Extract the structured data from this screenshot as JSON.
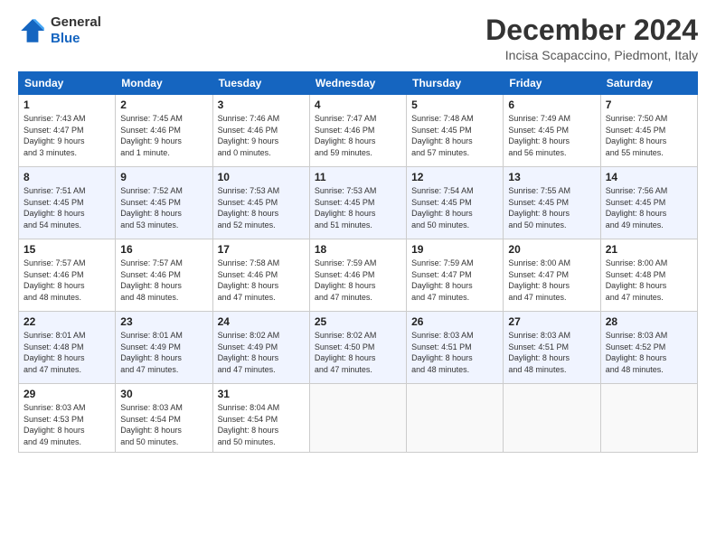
{
  "logo": {
    "line1": "General",
    "line2": "Blue"
  },
  "header": {
    "month": "December 2024",
    "location": "Incisa Scapaccino, Piedmont, Italy"
  },
  "weekdays": [
    "Sunday",
    "Monday",
    "Tuesday",
    "Wednesday",
    "Thursday",
    "Friday",
    "Saturday"
  ],
  "weeks": [
    [
      {
        "day": 1,
        "info": "Sunrise: 7:43 AM\nSunset: 4:47 PM\nDaylight: 9 hours\nand 3 minutes."
      },
      {
        "day": 2,
        "info": "Sunrise: 7:45 AM\nSunset: 4:46 PM\nDaylight: 9 hours\nand 1 minute."
      },
      {
        "day": 3,
        "info": "Sunrise: 7:46 AM\nSunset: 4:46 PM\nDaylight: 9 hours\nand 0 minutes."
      },
      {
        "day": 4,
        "info": "Sunrise: 7:47 AM\nSunset: 4:46 PM\nDaylight: 8 hours\nand 59 minutes."
      },
      {
        "day": 5,
        "info": "Sunrise: 7:48 AM\nSunset: 4:45 PM\nDaylight: 8 hours\nand 57 minutes."
      },
      {
        "day": 6,
        "info": "Sunrise: 7:49 AM\nSunset: 4:45 PM\nDaylight: 8 hours\nand 56 minutes."
      },
      {
        "day": 7,
        "info": "Sunrise: 7:50 AM\nSunset: 4:45 PM\nDaylight: 8 hours\nand 55 minutes."
      }
    ],
    [
      {
        "day": 8,
        "info": "Sunrise: 7:51 AM\nSunset: 4:45 PM\nDaylight: 8 hours\nand 54 minutes."
      },
      {
        "day": 9,
        "info": "Sunrise: 7:52 AM\nSunset: 4:45 PM\nDaylight: 8 hours\nand 53 minutes."
      },
      {
        "day": 10,
        "info": "Sunrise: 7:53 AM\nSunset: 4:45 PM\nDaylight: 8 hours\nand 52 minutes."
      },
      {
        "day": 11,
        "info": "Sunrise: 7:53 AM\nSunset: 4:45 PM\nDaylight: 8 hours\nand 51 minutes."
      },
      {
        "day": 12,
        "info": "Sunrise: 7:54 AM\nSunset: 4:45 PM\nDaylight: 8 hours\nand 50 minutes."
      },
      {
        "day": 13,
        "info": "Sunrise: 7:55 AM\nSunset: 4:45 PM\nDaylight: 8 hours\nand 50 minutes."
      },
      {
        "day": 14,
        "info": "Sunrise: 7:56 AM\nSunset: 4:45 PM\nDaylight: 8 hours\nand 49 minutes."
      }
    ],
    [
      {
        "day": 15,
        "info": "Sunrise: 7:57 AM\nSunset: 4:46 PM\nDaylight: 8 hours\nand 48 minutes."
      },
      {
        "day": 16,
        "info": "Sunrise: 7:57 AM\nSunset: 4:46 PM\nDaylight: 8 hours\nand 48 minutes."
      },
      {
        "day": 17,
        "info": "Sunrise: 7:58 AM\nSunset: 4:46 PM\nDaylight: 8 hours\nand 47 minutes."
      },
      {
        "day": 18,
        "info": "Sunrise: 7:59 AM\nSunset: 4:46 PM\nDaylight: 8 hours\nand 47 minutes."
      },
      {
        "day": 19,
        "info": "Sunrise: 7:59 AM\nSunset: 4:47 PM\nDaylight: 8 hours\nand 47 minutes."
      },
      {
        "day": 20,
        "info": "Sunrise: 8:00 AM\nSunset: 4:47 PM\nDaylight: 8 hours\nand 47 minutes."
      },
      {
        "day": 21,
        "info": "Sunrise: 8:00 AM\nSunset: 4:48 PM\nDaylight: 8 hours\nand 47 minutes."
      }
    ],
    [
      {
        "day": 22,
        "info": "Sunrise: 8:01 AM\nSunset: 4:48 PM\nDaylight: 8 hours\nand 47 minutes."
      },
      {
        "day": 23,
        "info": "Sunrise: 8:01 AM\nSunset: 4:49 PM\nDaylight: 8 hours\nand 47 minutes."
      },
      {
        "day": 24,
        "info": "Sunrise: 8:02 AM\nSunset: 4:49 PM\nDaylight: 8 hours\nand 47 minutes."
      },
      {
        "day": 25,
        "info": "Sunrise: 8:02 AM\nSunset: 4:50 PM\nDaylight: 8 hours\nand 47 minutes."
      },
      {
        "day": 26,
        "info": "Sunrise: 8:03 AM\nSunset: 4:51 PM\nDaylight: 8 hours\nand 48 minutes."
      },
      {
        "day": 27,
        "info": "Sunrise: 8:03 AM\nSunset: 4:51 PM\nDaylight: 8 hours\nand 48 minutes."
      },
      {
        "day": 28,
        "info": "Sunrise: 8:03 AM\nSunset: 4:52 PM\nDaylight: 8 hours\nand 48 minutes."
      }
    ],
    [
      {
        "day": 29,
        "info": "Sunrise: 8:03 AM\nSunset: 4:53 PM\nDaylight: 8 hours\nand 49 minutes."
      },
      {
        "day": 30,
        "info": "Sunrise: 8:03 AM\nSunset: 4:54 PM\nDaylight: 8 hours\nand 50 minutes."
      },
      {
        "day": 31,
        "info": "Sunrise: 8:04 AM\nSunset: 4:54 PM\nDaylight: 8 hours\nand 50 minutes."
      },
      null,
      null,
      null,
      null
    ]
  ]
}
